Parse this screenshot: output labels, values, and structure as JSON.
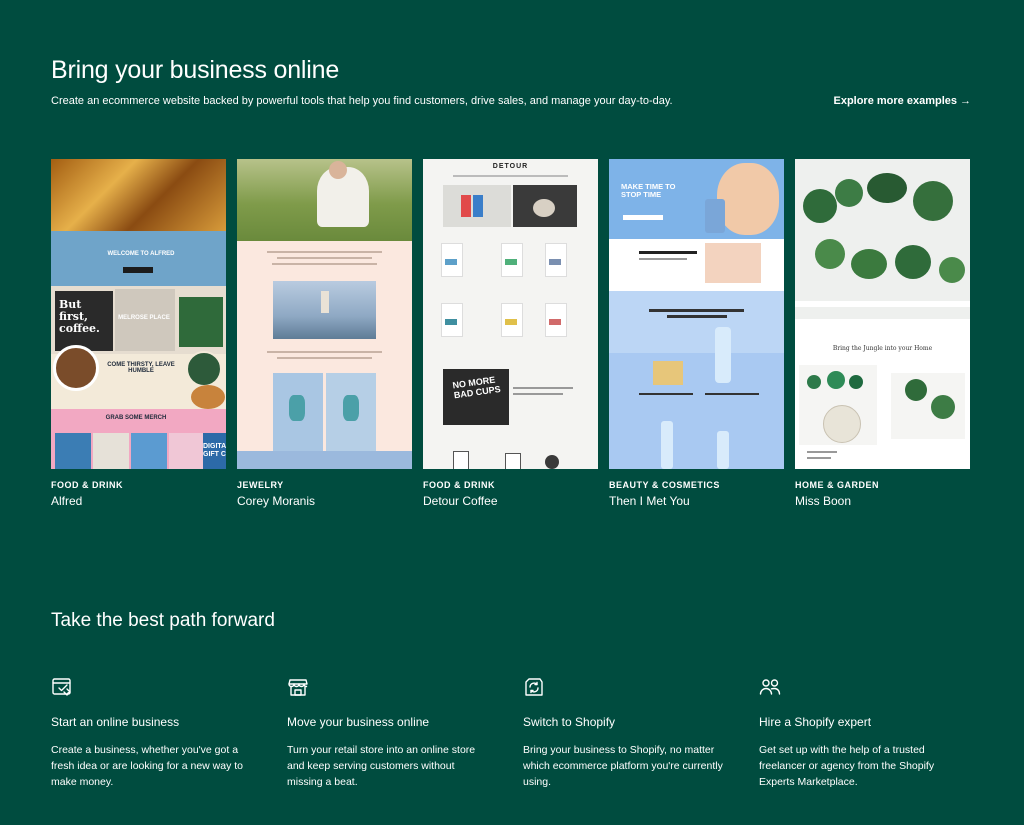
{
  "hero": {
    "title": "Bring your business online",
    "subtitle": "Create an ecommerce website backed by powerful tools that help you find customers, drive sales, and manage your day-to-day.",
    "explore_label": "Explore more examples",
    "explore_arrow": "→"
  },
  "examples": [
    {
      "category": "FOOD & DRINK",
      "name": "Alfred"
    },
    {
      "category": "JEWELRY",
      "name": "Corey Moranis"
    },
    {
      "category": "FOOD & DRINK",
      "name": "Detour Coffee"
    },
    {
      "category": "BEAUTY & COSMETICS",
      "name": "Then I Met You"
    },
    {
      "category": "HOME & GARDEN",
      "name": "Miss Boon"
    }
  ],
  "thumb_text": {
    "alfred_welcome": "WELCOME TO ALFRED",
    "alfred_coffee": "But first, coffee.",
    "alfred_melrose": "MELROSE PLACE",
    "alfred_thirsty": "COME THIRSTY, LEAVE HUMBLE",
    "alfred_merch": "GRAB SOME MERCH",
    "alfred_gift": "DIGITAL GIFT C",
    "detour_logo": "DETOUR",
    "detour_cups": "NO MORE BAD CUPS",
    "timyou_headline": "MAKE TIME TO STOP TIME",
    "missboon_tagline": "Bring the Jungle into your Home"
  },
  "path": {
    "title": "Take the best path forward",
    "features": [
      {
        "icon": "store-setup-icon",
        "title": "Start an online business",
        "text": "Create a business, whether you've got a fresh idea or are looking for a new way to make money."
      },
      {
        "icon": "storefront-icon",
        "title": "Move your business online",
        "text": "Turn your retail store into an online store and keep serving customers without missing a beat."
      },
      {
        "icon": "switch-icon",
        "title": "Switch to Shopify",
        "text": "Bring your business to Shopify, no matter which ecommerce platform you're currently using."
      },
      {
        "icon": "people-icon",
        "title": "Hire a Shopify expert",
        "text": "Get set up with the help of a trusted freelancer or agency from the Shopify Experts Marketplace."
      }
    ]
  }
}
